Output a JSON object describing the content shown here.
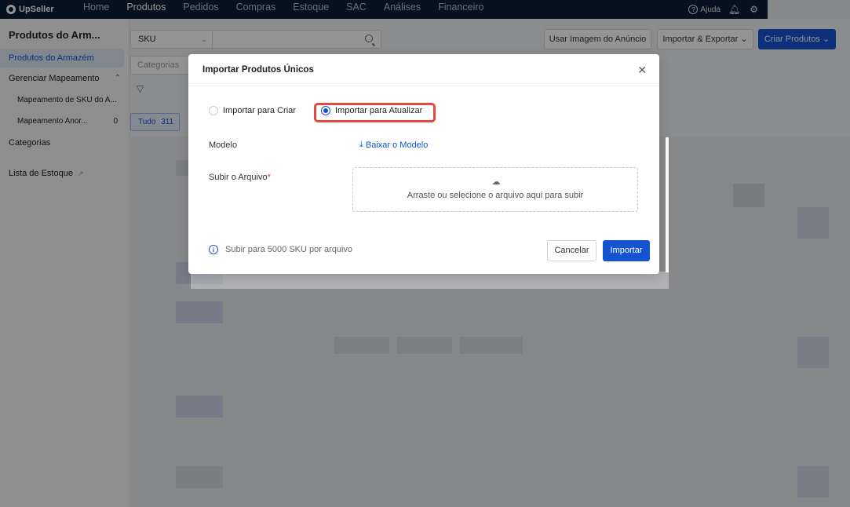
{
  "app": {
    "logo_text": "UpSeller"
  },
  "nav": {
    "items": [
      "Home",
      "Produtos",
      "Pedidos",
      "Compras",
      "Estoque",
      "SAC",
      "Análises",
      "Financeiro"
    ],
    "active": "Produtos",
    "help_label": "Ajuda"
  },
  "sidebar": {
    "title": "Produtos do Arm...",
    "items": [
      {
        "label": "Produtos do Armazém",
        "active": true
      },
      {
        "label": "Gerenciar Mapeamento"
      },
      {
        "label": "Mapeamento de SKU do A..."
      },
      {
        "label": "Mapeamento Anor...",
        "count": "0"
      },
      {
        "label": "Categorias"
      },
      {
        "label": "Lista de Estoque"
      }
    ]
  },
  "toolbar": {
    "search_type": "SKU",
    "search_placeholder": "",
    "category_placeholder": "Categorias",
    "btn_image": "Usar Imagem do Anúncio",
    "btn_import_export": "Importar & Exportar",
    "btn_create": "Criar Produtos",
    "tab_all_label": "Tudo",
    "tab_all_count": "311"
  },
  "modal": {
    "title": "Importar Produtos Únicos",
    "radio_create": "Importar para Criar",
    "radio_update": "Importar para Atualizar",
    "selected": "update",
    "template_label": "Modelo",
    "template_link": "Baixar o Modelo",
    "file_label": "Subir o Arquivo",
    "required_mark": "*",
    "upload_hint": "Arraste ou selecione o arquivo aqui para subir",
    "info_text": "Subir para 5000 SKU por arquivo",
    "cancel": "Cancelar",
    "confirm": "Importar"
  },
  "colors": {
    "primary": "#1554d0",
    "nav_bg": "#0b1e36",
    "highlight": "#e5483f"
  }
}
